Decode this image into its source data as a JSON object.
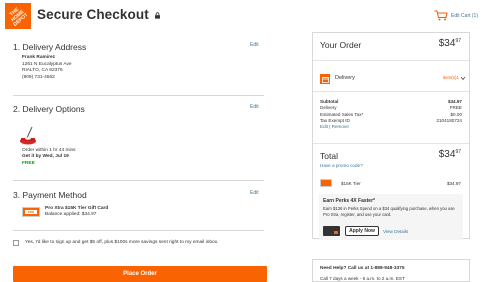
{
  "header": {
    "logo_text": "THE HOME DEPOT",
    "title": "Secure Checkout",
    "cart_label": "Edit Cart (1)",
    "brand_color": "#f96302",
    "link_color": "#3e7697"
  },
  "delivery_address": {
    "heading": "1. Delivery Address",
    "edit": "Edit",
    "name": "Frank Ramirez",
    "street": "1261 N Eucalyptus Ave",
    "city": "RIALTO, CA 92376",
    "phone": "(909) 731-4562"
  },
  "delivery_options": {
    "heading": "2. Delivery Options",
    "edit": "Edit",
    "order_within": "Order within 1 hr 44 mins",
    "get_it_by": "Get it by Wed, Jul 19",
    "cost": "FREE"
  },
  "payment": {
    "heading": "3. Payment Method",
    "edit": "Edit",
    "card_name": "Pro Xtra $15K Tier Gift Card",
    "balance": "Balance applied: $34.97"
  },
  "signup": {
    "label": "Yes, I'd like to sign up and get $5 off, plus $100s more savings sent right to my email inbox."
  },
  "place_order": {
    "label": "Place Order"
  },
  "order_summary": {
    "title": "Your Order",
    "price_dollars": "$34",
    "price_cents": "97",
    "delivery_label": "Delivery",
    "delivery_items": "item(s)1",
    "lines": [
      {
        "label": "Subtotal",
        "value": "$34.97"
      },
      {
        "label": "Delivery",
        "value": "FREE"
      },
      {
        "label": "Estimated Sales Tax*",
        "value": "$0.00"
      },
      {
        "label": "Tax Exempt ID",
        "value": "2104180724"
      }
    ],
    "edit_remove": "Edit | Remove",
    "total_label": "Total",
    "total_dollars": "$34",
    "total_cents": "97",
    "promo": "Have a promo code?",
    "giftcard_name": "$15K Tier",
    "giftcard_value": "$34.97",
    "perks_title": "Earn Perks 4X Faster*",
    "perks_body": "Earn $136 in Perks Spend on a $34 qualifying purchase, when you use Pro Xtra, register, and use your card.",
    "apply_now": "Apply Now",
    "view_details": "View Details"
  },
  "help": {
    "line1": "Need Help? Call us at 1-888-948-3375",
    "line2": "Call 7 days a week - 6 a.m. to 2 a.m. EST"
  }
}
